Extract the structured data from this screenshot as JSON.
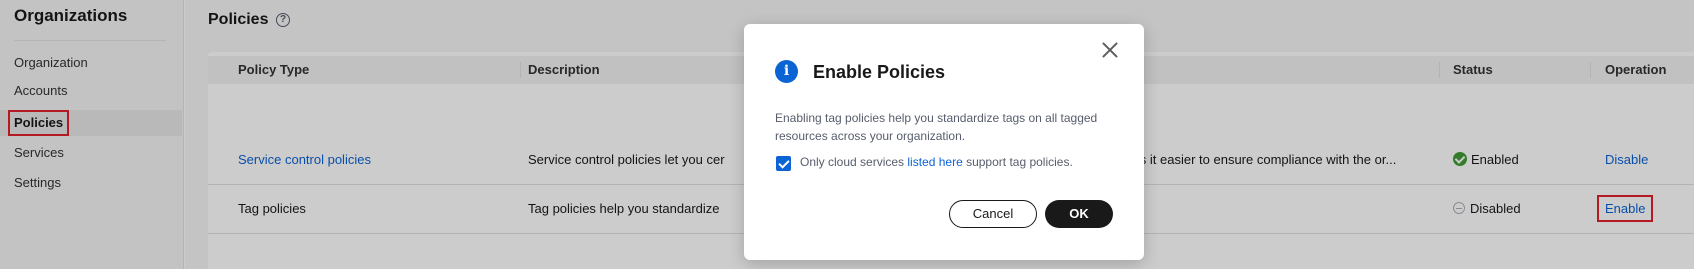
{
  "sidebar": {
    "title": "Organizations",
    "items": [
      {
        "label": "Organization"
      },
      {
        "label": "Accounts"
      },
      {
        "label": "Policies"
      },
      {
        "label": "Services"
      },
      {
        "label": "Settings"
      }
    ]
  },
  "page": {
    "title": "Policies",
    "help_glyph": "?"
  },
  "table": {
    "headers": [
      "Policy Type",
      "Description",
      "Status",
      "Operation"
    ],
    "rows": [
      {
        "policy_type": "Service control policies",
        "description": "Service control policies let you cer",
        "description_tail": "makes it easier to ensure compliance with the or...",
        "status": "Enabled",
        "operation": "Disable"
      },
      {
        "policy_type": "Tag policies",
        "description": "Tag policies help you standardize",
        "description_tail": "",
        "status": "Disabled",
        "operation": "Enable"
      }
    ]
  },
  "modal": {
    "title": "Enable Policies",
    "info_glyph": "i",
    "body": "Enabling tag policies help you standardize tags on all tagged resources across your organization.",
    "checkbox_prefix": "Only cloud services ",
    "checkbox_link": "listed here",
    "checkbox_suffix": " support tag policies.",
    "checkbox_checked": true,
    "cancel_label": "Cancel",
    "ok_label": "OK"
  },
  "colors": {
    "accent": "#0c63d4",
    "highlight": "#e0212d",
    "enabled": "#3f9c35"
  }
}
